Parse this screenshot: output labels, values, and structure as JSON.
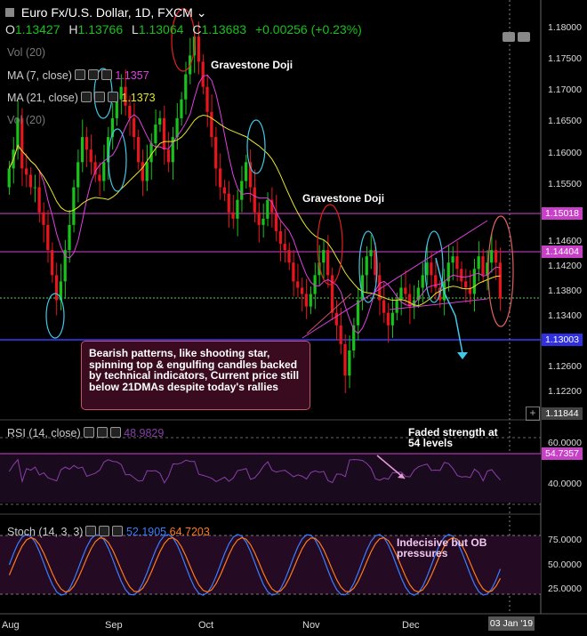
{
  "header": {
    "symbol": "Euro Fx/U.S. Dollar, 1D, FXCM",
    "o_label": "O",
    "o_value": "1.13427",
    "h_label": "H",
    "h_value": "1.13766",
    "l_label": "L",
    "l_value": "1.13064",
    "c_label": "C",
    "c_value": "1.13683",
    "change": "+0.00256 (+0.23%)"
  },
  "indicators": {
    "vol1": "Vol (20)",
    "ma7": "MA (7, close)",
    "ma7_value": "1.1357",
    "ma21": "MA (21, close)",
    "ma21_value": "1.1373",
    "vol2": "Vol (20)",
    "rsi": "RSI (14, close)",
    "rsi_value": "48.9829",
    "stoch": "Stoch (14, 3, 3)",
    "stoch_k": "52.1905",
    "stoch_d": "64.7203"
  },
  "annotations": {
    "doji1": "Gravestone Doji",
    "doji2": "Gravestone Doji",
    "callout": "Bearish patterns, like shooting star, spinning top & engulfing candles backed by technical indicators, Current price still below 21DMAs despite today's rallies",
    "rsi_note": "Faded strength at 54 levels",
    "stoch_note": "Indecisive but OB pressures"
  },
  "price_tags": {
    "resistance": "1.15018",
    "line2": "1.14404",
    "support": "1.13003",
    "bottom": "1.11844",
    "rsi_tag": "54.7357"
  },
  "axis": {
    "price_ticks": [
      "1.18000",
      "1.17500",
      "1.17000",
      "1.16500",
      "1.16000",
      "1.15500",
      "1.14600",
      "1.14200",
      "1.13800",
      "1.13400",
      "1.12600",
      "1.12200"
    ],
    "rsi_ticks": [
      "60.0000",
      "40.0000"
    ],
    "stoch_ticks": [
      "75.0000",
      "50.0000",
      "25.0000"
    ],
    "x_ticks": [
      "Aug",
      "Sep",
      "Oct",
      "Nov",
      "Dec"
    ],
    "current_date": "03 Jan '19"
  },
  "colors": {
    "up": "#18c21b",
    "down": "#e8151d",
    "ma7": "#e040e0",
    "ma21": "#e6e62a",
    "hline": "#d63fd6",
    "support": "#3a3aff",
    "rsi": "#8a3fa8",
    "stoch_k": "#3b7dff",
    "stoch_d": "#ff7a1a"
  },
  "chart_data": {
    "type": "candlestick",
    "title": "Euro Fx/U.S. Dollar, 1D, FXCM",
    "ylim": [
      1.11844,
      1.1815
    ],
    "horizontal_levels": [
      1.15018,
      1.14404,
      1.13003
    ],
    "close_series": [
      1.1575,
      1.1605,
      1.1655,
      1.1575,
      1.1565,
      1.1545,
      1.1545,
      1.1505,
      1.1485,
      1.1445,
      1.1405,
      1.1365,
      1.1395,
      1.1445,
      1.1485,
      1.1545,
      1.1585,
      1.1625,
      1.1605,
      1.1585,
      1.1565,
      1.1555,
      1.1585,
      1.1625,
      1.1655,
      1.1685,
      1.1705,
      1.1675,
      1.1655,
      1.1625,
      1.1585,
      1.1555,
      1.1585,
      1.1615,
      1.1645,
      1.1655,
      1.1605,
      1.1585,
      1.1625,
      1.1655,
      1.1685,
      1.1725,
      1.1755,
      1.1785,
      1.1745,
      1.1705,
      1.1665,
      1.1625,
      1.1575,
      1.1545,
      1.1535,
      1.1505,
      1.1495,
      1.1525,
      1.1555,
      1.1585,
      1.1545,
      1.1505,
      1.1485,
      1.1495,
      1.1525,
      1.1505,
      1.1475,
      1.1455,
      1.1445,
      1.1425,
      1.1395,
      1.1385,
      1.1375,
      1.1355,
      1.1375,
      1.1405,
      1.1425,
      1.1445,
      1.1405,
      1.1345,
      1.1325,
      1.1295,
      1.1245,
      1.1285,
      1.1325,
      1.1365,
      1.1405,
      1.1435,
      1.1445,
      1.1405,
      1.1365,
      1.1345,
      1.1325,
      1.1345,
      1.1365,
      1.1385,
      1.1375,
      1.1355,
      1.1365,
      1.1385,
      1.1405,
      1.1425,
      1.1405,
      1.1385,
      1.1365,
      1.1395,
      1.1425,
      1.1435,
      1.1415,
      1.1395,
      1.1385,
      1.1375,
      1.1415,
      1.1435,
      1.1405,
      1.1425,
      1.1445,
      1.1425,
      1.1368
    ],
    "rsi_ticks": [
      60,
      40
    ],
    "rsi_current": 48.9829,
    "stoch_k_current": 52.1905,
    "stoch_d_current": 64.7203
  }
}
